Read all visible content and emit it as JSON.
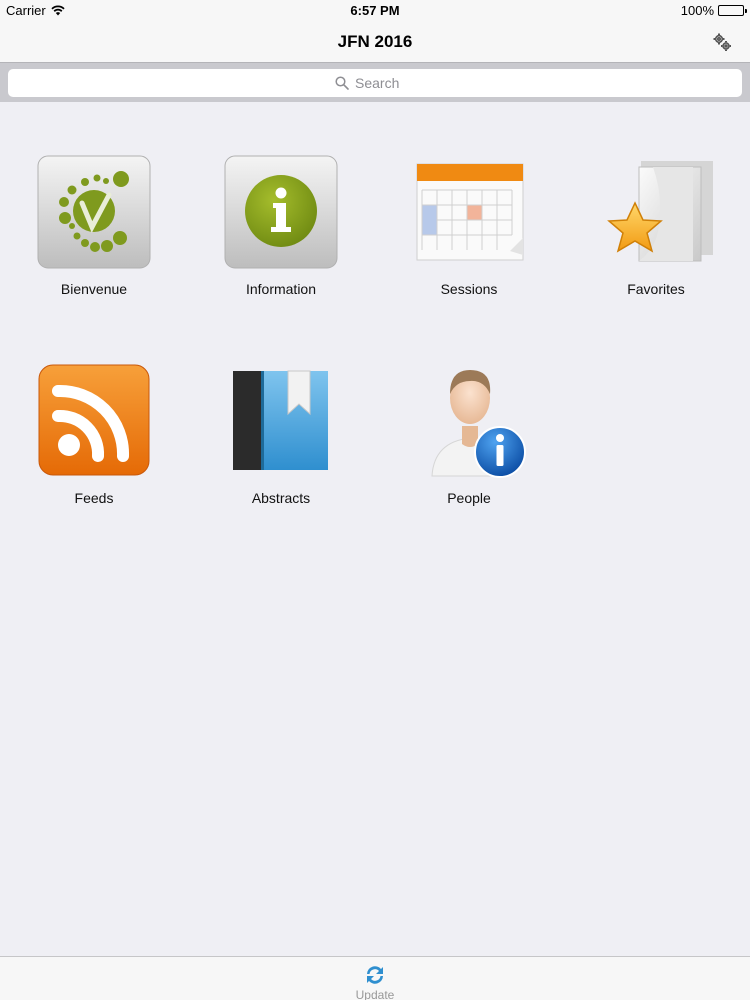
{
  "status_bar": {
    "carrier": "Carrier",
    "time": "6:57 PM",
    "battery": "100%"
  },
  "nav": {
    "title": "JFN 2016",
    "settings_icon": "gears-icon"
  },
  "search": {
    "placeholder": "Search",
    "value": ""
  },
  "tiles": [
    {
      "label": "Bienvenue",
      "icon": "jfn-logo-icon"
    },
    {
      "label": "Information",
      "icon": "info-icon"
    },
    {
      "label": "Sessions",
      "icon": "calendar-icon"
    },
    {
      "label": "Favorites",
      "icon": "favorites-folder-icon"
    },
    {
      "label": "Feeds",
      "icon": "rss-icon"
    },
    {
      "label": "Abstracts",
      "icon": "book-icon"
    },
    {
      "label": "People",
      "icon": "person-info-icon"
    }
  ],
  "tab_bar": {
    "update_label": "Update",
    "update_icon": "refresh-icon"
  },
  "colors": {
    "accent_blue": "#2f8fcf",
    "olive": "#8aa31f",
    "orange": "#f28c0f"
  }
}
